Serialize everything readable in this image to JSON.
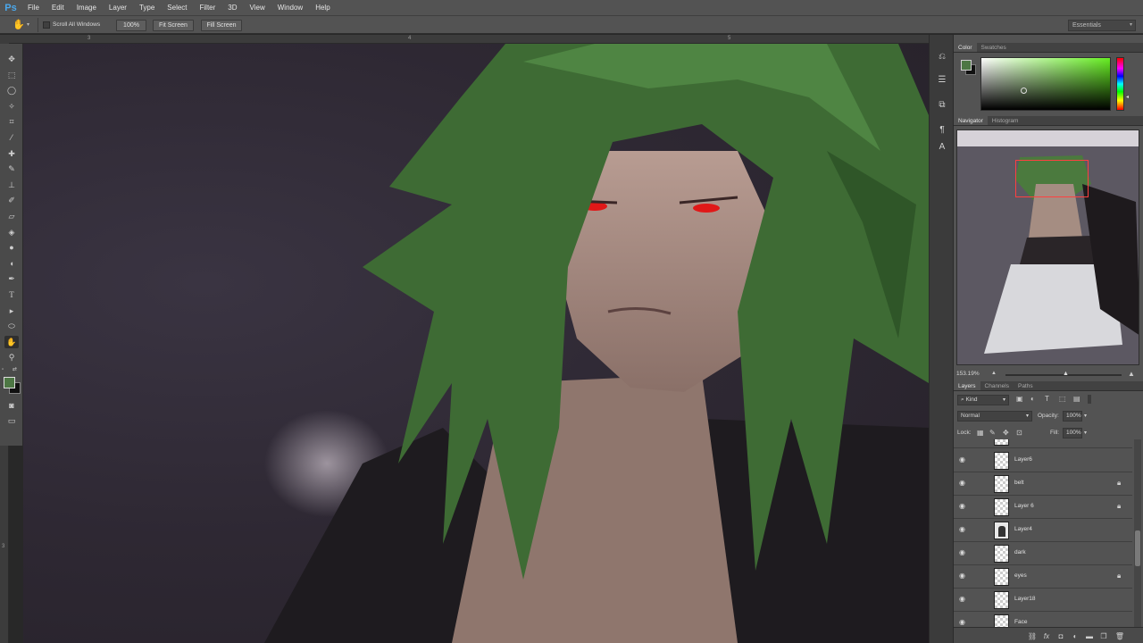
{
  "app": {
    "logo": "Ps"
  },
  "menu": [
    "File",
    "Edit",
    "Image",
    "Layer",
    "Type",
    "Select",
    "Filter",
    "3D",
    "View",
    "Window",
    "Help"
  ],
  "options": {
    "scroll_all_label": "Scroll All Windows",
    "zoom_100": "100%",
    "fit_screen": "Fit Screen",
    "fill_screen": "Fill Screen",
    "workspace": "Essentials"
  },
  "rulers": {
    "top_ticks": [
      "3",
      "4",
      "5"
    ],
    "left_ticks": [
      "3"
    ]
  },
  "color_panel": {
    "tabs": [
      "Color",
      "Swatches"
    ],
    "foreground": "#4d7744",
    "background": "#111111"
  },
  "navigator": {
    "tabs": [
      "Navigator",
      "Histogram"
    ],
    "zoom": "153.19%"
  },
  "layers_panel": {
    "tabs": [
      "Layers",
      "Channels",
      "Paths"
    ],
    "filter_kind": "Kind",
    "blend_mode": "Normal",
    "opacity_label": "Opacity:",
    "opacity": "100%",
    "lock_label": "Lock:",
    "fill_label": "Fill:",
    "fill": "100%",
    "layers": [
      {
        "name": "Layer6",
        "locked": false
      },
      {
        "name": "belt",
        "locked": true
      },
      {
        "name": "Layer 6",
        "locked": true
      },
      {
        "name": "Layer4",
        "locked": false
      },
      {
        "name": "dark",
        "locked": false
      },
      {
        "name": "eyes",
        "locked": true
      },
      {
        "name": "Layer18",
        "locked": false
      },
      {
        "name": "Face",
        "locked": false
      }
    ]
  }
}
